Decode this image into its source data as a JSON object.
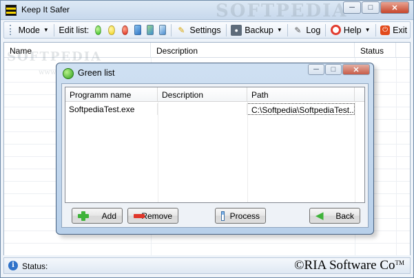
{
  "window": {
    "title": "Keep It Safer"
  },
  "toolbar": {
    "mode": "Mode",
    "edit_list": "Edit list:",
    "settings": "Settings",
    "backup": "Backup",
    "log": "Log",
    "help": "Help",
    "exit": "Exit"
  },
  "main_list": {
    "columns": [
      "Name",
      "Description",
      "Status"
    ]
  },
  "watermark": "SOFTPEDIA",
  "watermark_small": "www.softpedia.com",
  "dialog": {
    "title": "Green list",
    "columns": [
      "Programm name",
      "Description",
      "Path"
    ],
    "rows": [
      {
        "name": "SoftpediaTest.exe",
        "description": "",
        "path": "C:\\Softpedia\\SoftpediaTest...."
      }
    ],
    "buttons": {
      "add": "Add",
      "remove": "Remove",
      "process": "Process",
      "back": "Back"
    }
  },
  "status": {
    "label": "Status:",
    "copyright": "©RIA Software Co",
    "tm": "TM"
  },
  "colors": {
    "green": "#2fbf1f",
    "yellow": "#f2d21a",
    "red": "#e02818",
    "accent": "#6d8aa8",
    "close": "#c7462b"
  }
}
